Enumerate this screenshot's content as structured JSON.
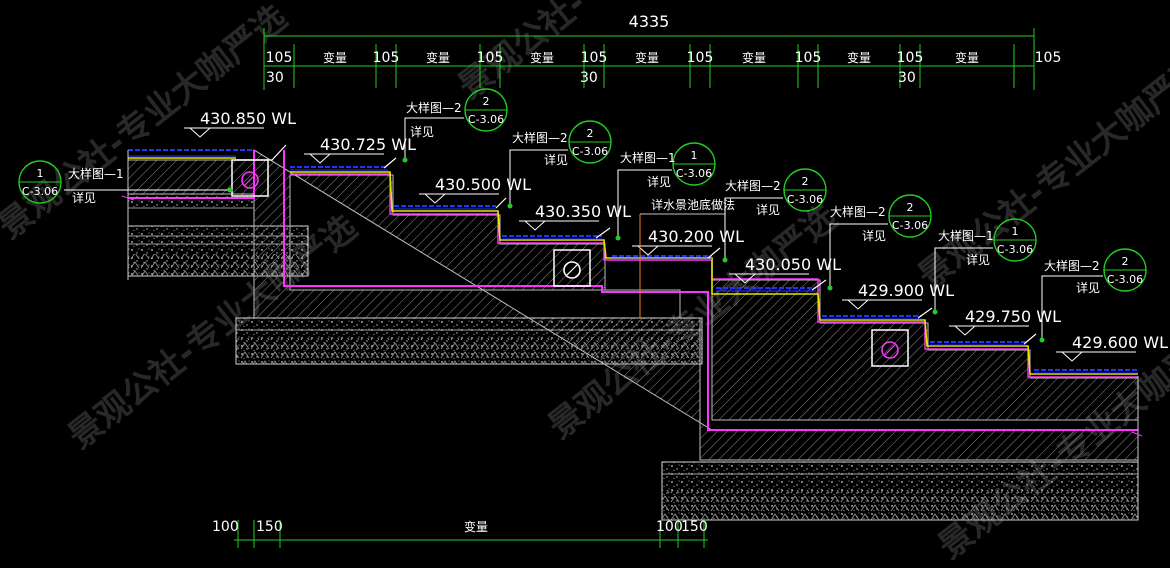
{
  "dimensions_top": {
    "overall": "4335",
    "segments": [
      "105",
      "变量",
      "105",
      "变量",
      "105",
      "变量",
      "105",
      "变量",
      "105",
      "变量",
      "105",
      "变量",
      "105",
      "变量",
      "105"
    ],
    "sub": [
      "30",
      "30",
      "30"
    ]
  },
  "dimensions_bottom": {
    "segments": [
      "100",
      "150",
      "变量",
      "100",
      "150"
    ]
  },
  "levels": [
    "430.850 WL",
    "430.725 WL",
    "430.500 WL",
    "430.350 WL",
    "430.200 WL",
    "430.050 WL",
    "429.900 WL",
    "429.750 WL",
    "429.600 WL"
  ],
  "callouts": [
    {
      "label": "大样图—1",
      "note": "详见",
      "num": "1",
      "sheet": "C-3.06"
    },
    {
      "label": "大样图—2",
      "note": "详见",
      "num": "2",
      "sheet": "C-3.06"
    },
    {
      "label": "大样图—2",
      "note": "详见",
      "num": "2",
      "sheet": "C-3.06"
    },
    {
      "label": "大样图—1",
      "note": "详见",
      "num": "1",
      "sheet": "C-3.06"
    },
    {
      "label": "大样图—2",
      "note": "详见",
      "num": "2",
      "sheet": "C-3.06"
    },
    {
      "label": "大样图—2",
      "note": "详见",
      "num": "2",
      "sheet": "C-3.06"
    },
    {
      "label": "大样图—1",
      "note": "详见",
      "num": "1",
      "sheet": "C-3.06"
    },
    {
      "label": "大样图—2",
      "note": "详见",
      "num": "2",
      "sheet": "C-3.06"
    }
  ],
  "pool_note": "详水景池底做法",
  "watermark": "景观公社-专业大咖严选",
  "colors": {
    "dim": "#22cc22",
    "water": "#2233ff",
    "membrane": "#ff33ff",
    "concrete": "#bbbbbb",
    "finish": "#e6e600",
    "bubble": "#22cc22"
  }
}
